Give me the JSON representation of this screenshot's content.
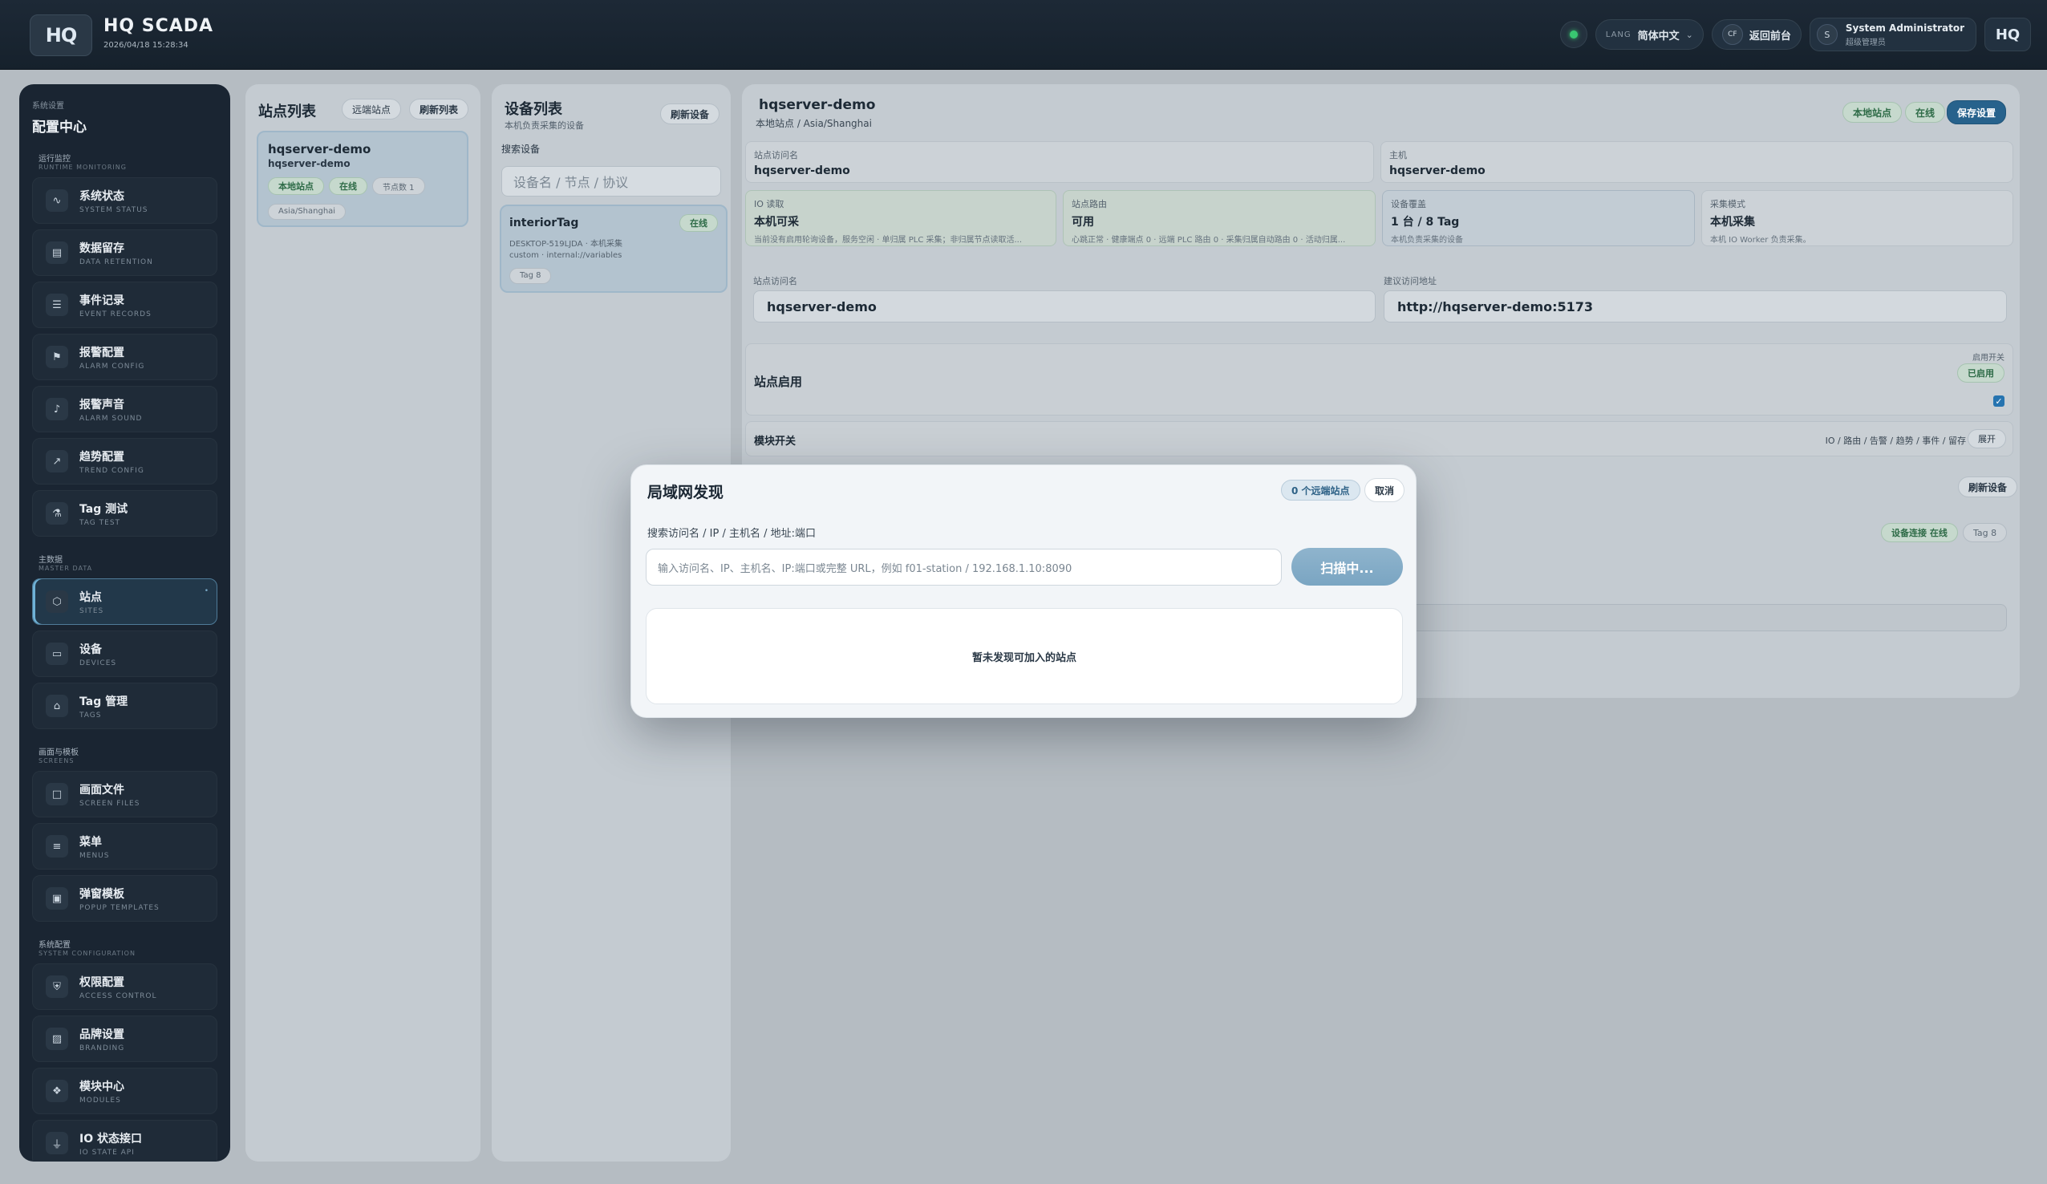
{
  "header": {
    "logo": "HQ",
    "title": "HQ SCADA",
    "timestamp": "2026/04/18 15:28:34",
    "lang_caption": "LANG",
    "language": "简体中文",
    "back_badge": "CF",
    "back_label": "返回前台",
    "user_initial": "S",
    "user_name": "System Administrator",
    "user_role": "超级管理员",
    "logo_small": "HQ"
  },
  "sidebar": {
    "caption": "系统设置",
    "title": "配置中心",
    "groups": [
      {
        "title_zh": "运行监控",
        "title_en": "RUNTIME MONITORING",
        "items": [
          {
            "zh": "系统状态",
            "en": "SYSTEM STATUS",
            "icon": "activity-icon"
          },
          {
            "zh": "数据留存",
            "en": "DATA RETENTION",
            "icon": "database-icon"
          },
          {
            "zh": "事件记录",
            "en": "EVENT RECORDS",
            "icon": "document-icon"
          },
          {
            "zh": "报警配置",
            "en": "ALARM CONFIG",
            "icon": "bell-icon"
          },
          {
            "zh": "报警声音",
            "en": "ALARM SOUND",
            "icon": "speaker-icon"
          },
          {
            "zh": "趋势配置",
            "en": "TREND CONFIG",
            "icon": "trend-icon"
          },
          {
            "zh": "Tag 测试",
            "en": "TAG TEST",
            "icon": "flask-icon"
          }
        ]
      },
      {
        "title_zh": "主数据",
        "title_en": "MASTER DATA",
        "items": [
          {
            "zh": "站点",
            "en": "SITES",
            "icon": "network-icon"
          },
          {
            "zh": "设备",
            "en": "DEVICES",
            "icon": "monitor-icon"
          },
          {
            "zh": "Tag 管理",
            "en": "TAGS",
            "icon": "tag-icon"
          }
        ]
      },
      {
        "title_zh": "画面与模板",
        "title_en": "SCREENS",
        "items": [
          {
            "zh": "画面文件",
            "en": "SCREEN FILES",
            "icon": "file-icon"
          },
          {
            "zh": "菜单",
            "en": "MENUS",
            "icon": "menu-icon"
          },
          {
            "zh": "弹窗模板",
            "en": "POPUP TEMPLATES",
            "icon": "window-icon"
          }
        ]
      },
      {
        "title_zh": "系统配置",
        "title_en": "SYSTEM CONFIGURATION",
        "items": [
          {
            "zh": "权限配置",
            "en": "ACCESS CONTROL",
            "icon": "shield-icon"
          },
          {
            "zh": "品牌设置",
            "en": "BRANDING",
            "icon": "image-icon"
          },
          {
            "zh": "模块中心",
            "en": "MODULES",
            "icon": "modules-icon"
          },
          {
            "zh": "IO 状态接口",
            "en": "IO STATE API",
            "icon": "plug-icon"
          }
        ]
      }
    ]
  },
  "stations": {
    "title": "站点列表",
    "remote_button": "远端站点",
    "refresh_button": "刷新列表",
    "card": {
      "name": "hqserver-demo",
      "host": "hqserver-demo",
      "badge_local": "本地站点",
      "badge_online": "在线",
      "badge_nodes": "节点数 1",
      "timezone": "Asia/Shanghai"
    }
  },
  "devices": {
    "title": "设备列表",
    "subtitle": "本机负责采集的设备",
    "refresh_button": "刷新设备",
    "search_label": "搜索设备",
    "search_placeholder": "设备名 / 节点 / 协议",
    "card": {
      "name": "interiorTag",
      "status": "在线",
      "line1": "DESKTOP-519LJDA · 本机采集",
      "line2": "custom · internal://variables",
      "tags": "Tag 8"
    }
  },
  "detail": {
    "name": "hqserver-demo",
    "subtitle": "本地站点 / Asia/Shanghai",
    "badge_local": "本地站点",
    "badge_online": "在线",
    "save_button": "保存设置",
    "access_name_label": "站点访问名",
    "access_name_value": "hqserver-demo",
    "host_label": "主机",
    "host_value": "hqserver-demo",
    "io_label": "IO 读取",
    "io_value": "本机可采",
    "io_sub": "当前没有启用轮询设备，服务空闲 · 单归属 PLC 采集；非归属节点读取活...",
    "route_label": "站点路由",
    "route_value": "可用",
    "route_sub": "心跳正常 · 健康端点 0 · 远端 PLC 路由 0 · 采集归属自动路由 0 · 活动归属...",
    "coverage_label": "设备覆盖",
    "coverage_value": "1 台 / 8 Tag",
    "coverage_sub": "本机负责采集的设备",
    "mode_label": "采集模式",
    "mode_value": "本机采集",
    "mode_sub": "本机 IO Worker 负责采集。",
    "access_input_label": "站点访问名",
    "access_input_value": "hqserver-demo",
    "url_label": "建议访问地址",
    "url_value": "http://hqserver-demo:5173",
    "enable_title": "站点启用",
    "enable_caption": "启用开关",
    "enable_badge": "已启用",
    "module_title": "模块开关",
    "module_summary": "IO / 路由 / 告警 / 趋势 / 事件 / 留存",
    "module_expand": "展开",
    "refresh_devices": "刷新设备",
    "device_conn": "设备连接 在线",
    "device_tags": "Tag 8"
  },
  "modal": {
    "title": "局域网发现",
    "badge": "0 个远端站点",
    "cancel": "取消",
    "search_label": "搜索访问名 / IP / 主机名 / 地址:端口",
    "search_placeholder": "输入访问名、IP、主机名、IP:端口或完整 URL，例如 f01-station / 192.168.1.10:8090",
    "scan_button": "扫描中...",
    "empty_text": "暂未发现可加入的站点"
  }
}
